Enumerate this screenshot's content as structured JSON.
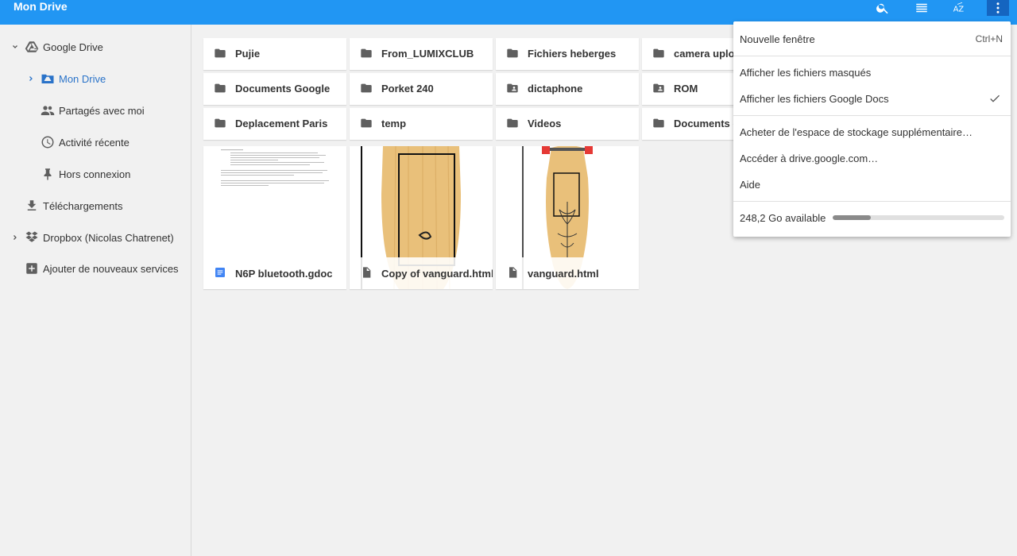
{
  "header": {
    "title": "Mon Drive"
  },
  "icons": {
    "search": "search-icon",
    "list_view": "list-view-icon",
    "sort": "sort-az-icon",
    "more": "more-vert-icon"
  },
  "sidebar": {
    "items": [
      {
        "label": "Google Drive",
        "icon": "drive-icon",
        "expanded": true
      },
      {
        "label": "Mon Drive",
        "icon": "my-drive-icon",
        "selected": true
      },
      {
        "label": "Partagés avec moi",
        "icon": "people-icon"
      },
      {
        "label": "Activité récente",
        "icon": "clock-icon"
      },
      {
        "label": "Hors connexion",
        "icon": "pin-icon"
      },
      {
        "label": "Téléchargements",
        "icon": "download-icon"
      },
      {
        "label": "Dropbox (Nicolas Chatrenet)",
        "icon": "dropbox-icon"
      },
      {
        "label": "Ajouter de nouveaux services",
        "icon": "add-box-icon"
      }
    ]
  },
  "folders": [
    {
      "name": "Pujie",
      "icon": "folder-icon"
    },
    {
      "name": "From_LUMIXCLUB",
      "icon": "folder-icon"
    },
    {
      "name": "Fichiers heberges",
      "icon": "folder-icon"
    },
    {
      "name": "camera uploads",
      "icon": "folder-icon"
    },
    {
      "name": "Documents Google",
      "icon": "folder-icon"
    },
    {
      "name": "Porket 240",
      "icon": "folder-icon"
    },
    {
      "name": "dictaphone",
      "icon": "shared-folder-icon"
    },
    {
      "name": "ROM",
      "icon": "shared-folder-icon"
    },
    {
      "name": "Deplacement Paris",
      "icon": "folder-icon"
    },
    {
      "name": "temp",
      "icon": "folder-icon"
    },
    {
      "name": "Videos",
      "icon": "folder-icon"
    },
    {
      "name": "Documents divers",
      "icon": "folder-icon"
    }
  ],
  "files": [
    {
      "name": "N6P bluetooth.gdoc",
      "icon": "google-doc-icon"
    },
    {
      "name": "Copy of vanguard.html",
      "icon": "file-icon"
    },
    {
      "name": "vanguard.html",
      "icon": "file-icon"
    }
  ],
  "menu": {
    "new_window": "Nouvelle fenêtre",
    "new_window_shortcut": "Ctrl+N",
    "show_hidden": "Afficher les fichiers masqués",
    "show_gdocs": "Afficher les fichiers Google Docs",
    "show_gdocs_checked": true,
    "buy_storage": "Acheter de l'espace de stockage supplémentaire…",
    "go_drive": "Accéder à drive.google.com…",
    "help": "Aide",
    "storage_available": "248,2 Go available",
    "storage_used_fraction": 0.22
  },
  "colors": {
    "header": "#2196f3",
    "accent": "#2a73c9",
    "skateboard_wood": "#e9c07a",
    "wheel": "#e53935"
  }
}
